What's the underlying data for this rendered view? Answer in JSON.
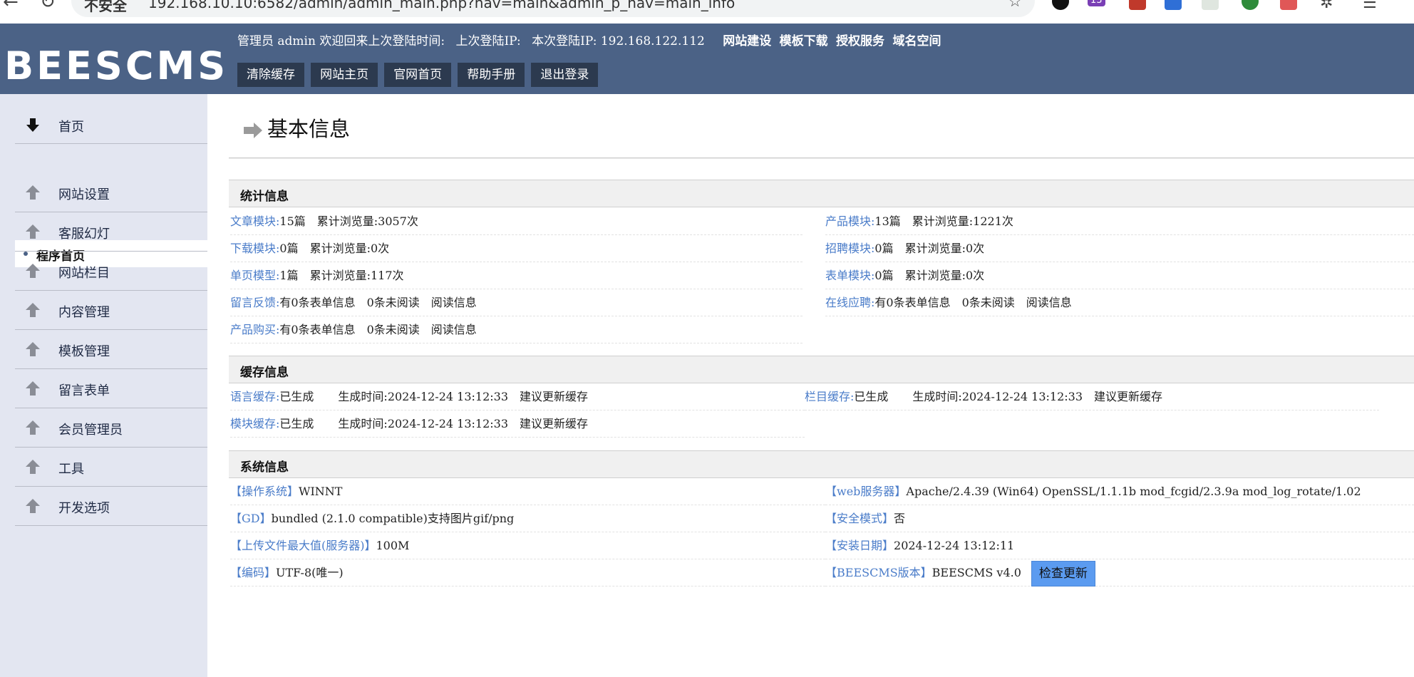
{
  "browser": {
    "url_warning": "不安全",
    "url": "192.168.10.10:6582/admin/admin_main.php?nav=main&admin_p_nav=main_info",
    "ext_badge": "13"
  },
  "header": {
    "logo": "BEESCMS",
    "welcome_prefix": "管理员 admin 欢迎回来上次登陆时间:",
    "last_ip_label": "上次登陆IP:",
    "current_ip_label": "本次登陆IP: 192.168.122.112",
    "links": [
      "网站建设",
      "模板下载",
      "授权服务",
      "域名空间"
    ],
    "buttons": [
      "清除缓存",
      "网站主页",
      "官网首页",
      "帮助手册",
      "退出登录"
    ]
  },
  "sidebar": {
    "home": "首页",
    "sub_item": "程序首页",
    "items": [
      "网站设置",
      "客服幻灯",
      "网站栏目",
      "内容管理",
      "模板管理",
      "留言表单",
      "会员管理员",
      "工具",
      "开发选项"
    ]
  },
  "main": {
    "title": "基本信息",
    "stats": {
      "heading": "统计信息",
      "left": [
        {
          "key": "文章模块:",
          "val": "15篇",
          "extra": "累计浏览量:3057次"
        },
        {
          "key": "下载模块:",
          "val": "0篇",
          "extra": "累计浏览量:0次"
        },
        {
          "key": "单页模型:",
          "val": "1篇",
          "extra": "累计浏览量:117次"
        },
        {
          "key": "留言反馈:",
          "val": "有0条表单信息",
          "extra": "0条未阅读",
          "extra2": "阅读信息"
        },
        {
          "key": "产品购买:",
          "val": "有0条表单信息",
          "extra": "0条未阅读",
          "extra2": "阅读信息"
        }
      ],
      "right": [
        {
          "key": "产品模块:",
          "val": "13篇",
          "extra": "累计浏览量:1221次"
        },
        {
          "key": "招聘模块:",
          "val": "0篇",
          "extra": "累计浏览量:0次"
        },
        {
          "key": "表单模块:",
          "val": "0篇",
          "extra": "累计浏览量:0次"
        },
        {
          "key": "在线应聘:",
          "val": "有0条表单信息",
          "extra": "0条未阅读",
          "extra2": "阅读信息"
        }
      ]
    },
    "cache": {
      "heading": "缓存信息",
      "rows": [
        {
          "key": "语言缓存:",
          "val": "已生成",
          "time": "生成时间:2024-12-24 13:12:33",
          "advice": "建议更新缓存"
        },
        {
          "key": "栏目缓存:",
          "val": "已生成",
          "time": "生成时间:2024-12-24 13:12:33",
          "advice": "建议更新缓存"
        },
        {
          "key": "模块缓存:",
          "val": "已生成",
          "time": "生成时间:2024-12-24 13:12:33",
          "advice": "建议更新缓存"
        }
      ]
    },
    "system": {
      "heading": "系统信息",
      "left": [
        {
          "key": "【操作系统】",
          "val": "WINNT"
        },
        {
          "key": "【GD】",
          "val": "bundled (2.1.0 compatible)支持图片gif/png"
        },
        {
          "key": "【上传文件最大值(服务器)】",
          "val": "100M"
        },
        {
          "key": "【编码】",
          "val": "UTF-8(唯一)"
        }
      ],
      "right": [
        {
          "key": "【web服务器】",
          "val": "Apache/2.4.39 (Win64) OpenSSL/1.1.1b mod_fcgid/2.3.9a mod_log_rotate/1.02"
        },
        {
          "key": "【安全模式】",
          "val": "否"
        },
        {
          "key": "【安装日期】",
          "val": "2024-12-24 13:12:11"
        },
        {
          "key": "【BEESCMS版本】",
          "val": "BEESCMS v4.0"
        }
      ],
      "check_update": "检查更新"
    }
  }
}
